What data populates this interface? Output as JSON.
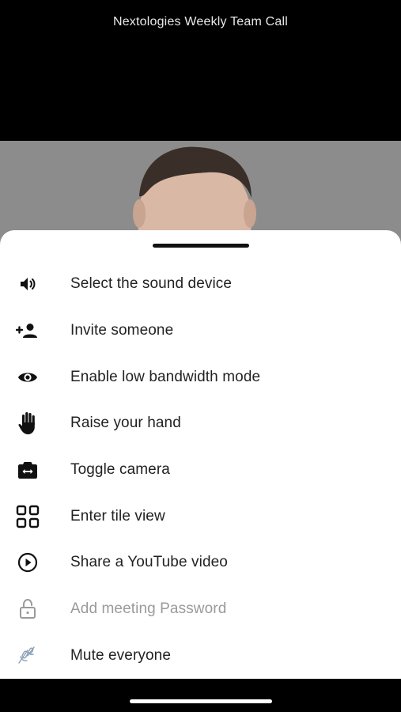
{
  "call": {
    "title": "Nextologies Weekly Team Call"
  },
  "menu": {
    "items": [
      {
        "label": "Select the sound device",
        "icon": "speaker-icon",
        "enabled": true
      },
      {
        "label": "Invite someone",
        "icon": "add-person-icon",
        "enabled": true
      },
      {
        "label": "Enable low bandwidth mode",
        "icon": "eye-icon",
        "enabled": true
      },
      {
        "label": "Raise your hand",
        "icon": "hand-icon",
        "enabled": true
      },
      {
        "label": "Toggle camera",
        "icon": "switch-camera-icon",
        "enabled": true
      },
      {
        "label": "Enter tile view",
        "icon": "tile-grid-icon",
        "enabled": true
      },
      {
        "label": "Share a YouTube video",
        "icon": "play-circle-icon",
        "enabled": true
      },
      {
        "label": "Add meeting Password",
        "icon": "lock-icon",
        "enabled": false
      },
      {
        "label": "Mute everyone",
        "icon": "mic-off-icon",
        "enabled": true
      }
    ]
  },
  "colors": {
    "sheet_background": "#ffffff",
    "text": "#222222",
    "disabled_text": "#9a9a9a",
    "video_background": "#8a8a8a"
  }
}
